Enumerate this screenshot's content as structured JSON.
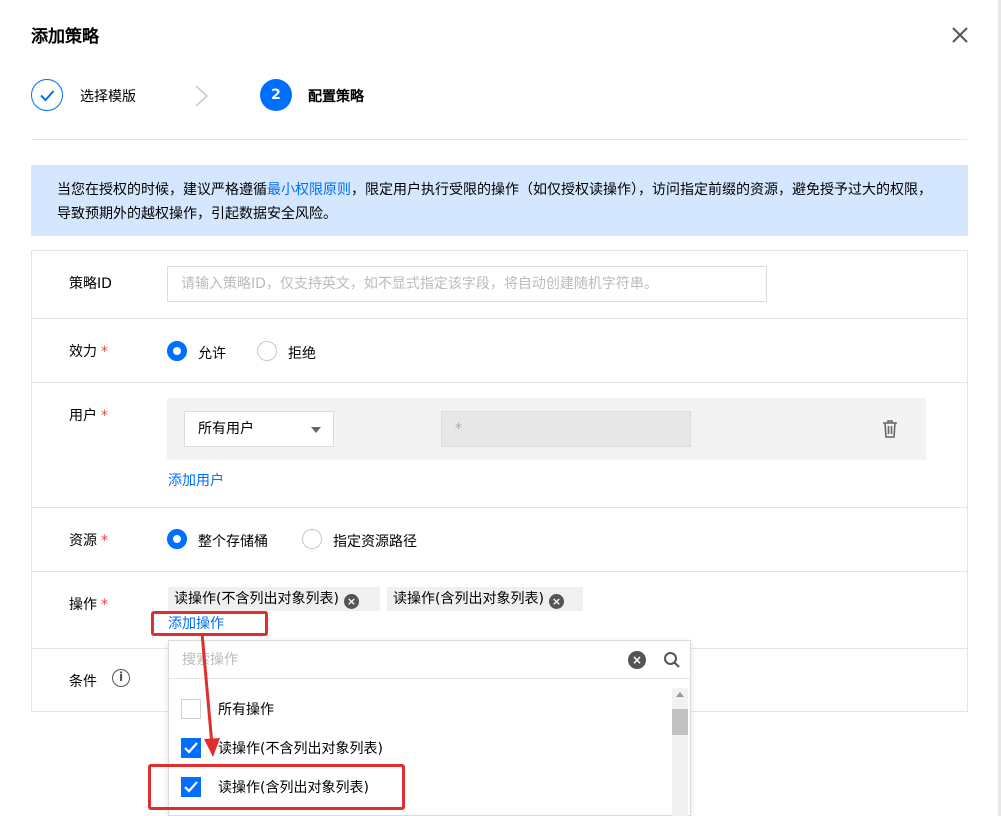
{
  "dialog": {
    "title": "添加策略"
  },
  "steps": [
    {
      "label": "选择模版",
      "state": "done"
    },
    {
      "number": "2",
      "label": "配置策略",
      "state": "active"
    }
  ],
  "notice": {
    "text_before": "当您在授权的时候，建议严格遵循",
    "link": "最小权限原则",
    "text_after": "，限定用户执行受限的操作（如仅授权读操作），访问指定前缀的资源，避免授予过大的权限，导致预期外的越权操作，引起数据安全风险。"
  },
  "form": {
    "policy_id": {
      "label": "策略ID",
      "placeholder": "请输入策略ID，仅支持英文，如不显式指定该字段，将自动创建随机字符串。"
    },
    "effect": {
      "label": "效力",
      "required_mark": "*",
      "options": [
        "允许",
        "拒绝"
      ],
      "selected": "允许"
    },
    "user": {
      "label": "用户",
      "required_mark": "*",
      "select_value": "所有用户",
      "value_placeholder": "*",
      "add_link": "添加用户"
    },
    "resource": {
      "label": "资源",
      "required_mark": "*",
      "options": [
        "整个存储桶",
        "指定资源路径"
      ],
      "selected": "整个存储桶"
    },
    "action": {
      "label": "操作",
      "required_mark": "*",
      "tags": [
        "读操作(不含列出对象列表)",
        "读操作(含列出对象列表)"
      ],
      "tag_remove_glyph": "×",
      "add_link": "添加操作"
    },
    "condition": {
      "label": "条件",
      "info_glyph": "i"
    }
  },
  "dropdown": {
    "search_placeholder": "搜索操作",
    "clear_glyph": "×",
    "items": [
      {
        "label": "所有操作",
        "checked": false
      },
      {
        "label": "读操作(不含列出对象列表)",
        "checked": true
      },
      {
        "label": "读操作(含列出对象列表)",
        "checked": true
      }
    ]
  },
  "colors": {
    "primary": "#006eff",
    "notice_bg": "#d5e7fe",
    "required": "#e54545",
    "annotation": "#e02d2d"
  }
}
